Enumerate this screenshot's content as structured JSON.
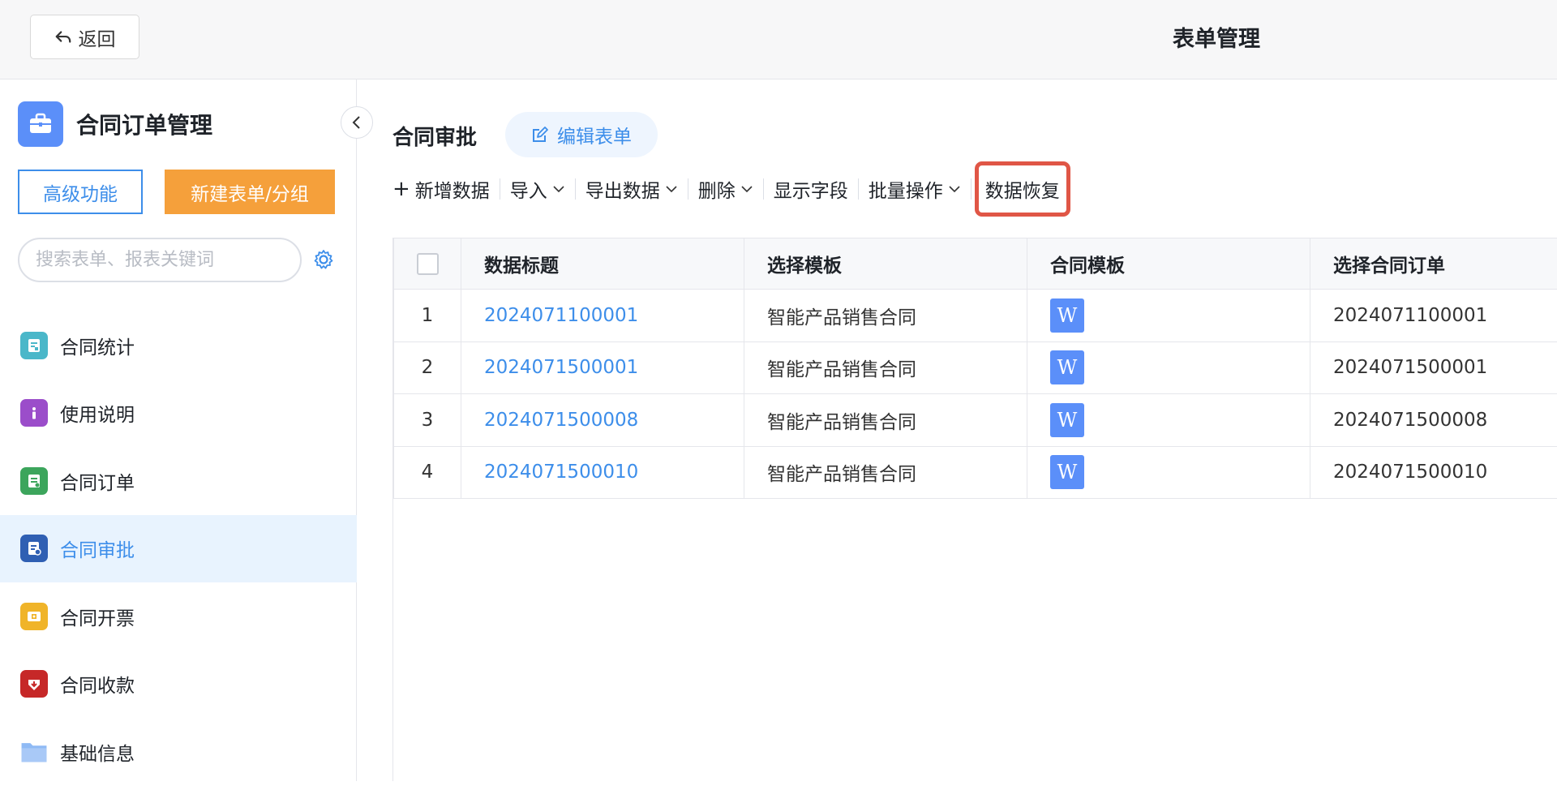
{
  "header": {
    "back_label": "返回",
    "title": "表单管理"
  },
  "sidebar": {
    "app_name": "合同订单管理",
    "btn_advanced": "高级功能",
    "btn_new": "新建表单/分组",
    "search_placeholder": "搜索表单、报表关键词",
    "items": [
      {
        "label": "合同统计",
        "icon": "chart-doc-icon",
        "color": "#4ab7c9"
      },
      {
        "label": "使用说明",
        "icon": "info-icon",
        "color": "#9b4dca"
      },
      {
        "label": "合同订单",
        "icon": "order-doc-icon",
        "color": "#3ca55c"
      },
      {
        "label": "合同审批",
        "icon": "approval-doc-icon",
        "color": "#2f5fb3",
        "active": true
      },
      {
        "label": "合同开票",
        "icon": "invoice-icon",
        "color": "#f0b429"
      },
      {
        "label": "合同收款",
        "icon": "payment-icon",
        "color": "#c62828"
      },
      {
        "label": "基础信息",
        "icon": "folder-icon",
        "color": "#8fbaf5"
      }
    ]
  },
  "main": {
    "form_title": "合同审批",
    "edit_form_label": "编辑表单",
    "toolbar": {
      "add": "新增数据",
      "import": "导入",
      "export": "导出数据",
      "delete": "删除",
      "fields": "显示字段",
      "batch": "批量操作",
      "restore": "数据恢复"
    },
    "table": {
      "columns": [
        "数据标题",
        "选择模板",
        "合同模板",
        "选择合同订单"
      ],
      "rows": [
        {
          "idx": "1",
          "title": "2024071100001",
          "template": "智能产品销售合同",
          "contract_template": "W",
          "order": "2024071100001"
        },
        {
          "idx": "2",
          "title": "2024071500001",
          "template": "智能产品销售合同",
          "contract_template": "W",
          "order": "2024071500001"
        },
        {
          "idx": "3",
          "title": "2024071500008",
          "template": "智能产品销售合同",
          "contract_template": "W",
          "order": "2024071500008"
        },
        {
          "idx": "4",
          "title": "2024071500010",
          "template": "智能产品销售合同",
          "contract_template": "W",
          "order": "2024071500010"
        }
      ]
    }
  },
  "colors": {
    "accent": "#3d8eea",
    "orange": "#f5a03b",
    "highlight": "#e05646"
  }
}
